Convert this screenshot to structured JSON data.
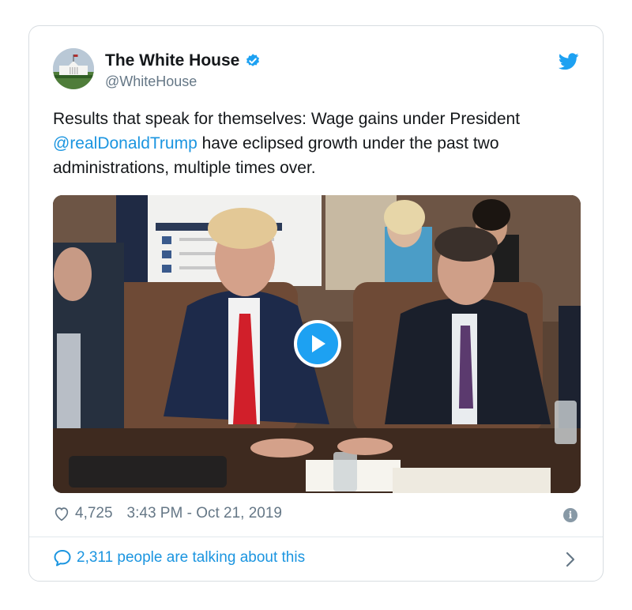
{
  "author": {
    "name": "The White House",
    "handle": "@WhiteHouse",
    "verified": true
  },
  "tweet": {
    "text_before": "Results that speak for themselves: Wage gains under President ",
    "mention": "@realDonaldTrump",
    "text_after": " have eclipsed growth under the past two administrations, multiple times over."
  },
  "media": {
    "type": "video",
    "play_icon": "play-icon"
  },
  "meta": {
    "likes": "4,725",
    "timestamp": "3:43 PM - Oct 21, 2019",
    "info_glyph": "i"
  },
  "footer": {
    "talking_text": "2,311 people are talking about this"
  },
  "colors": {
    "accent": "#1da1f2",
    "link": "#1b95e0",
    "muted": "#657786"
  }
}
